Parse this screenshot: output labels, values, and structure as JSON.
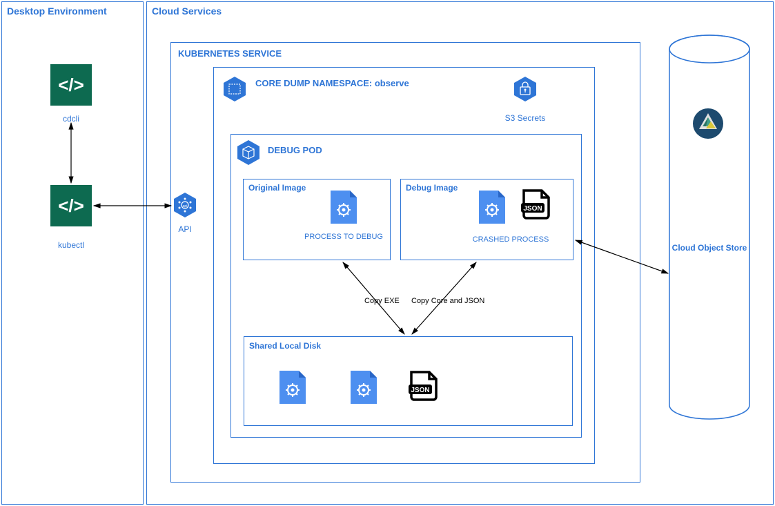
{
  "desktop": {
    "title": "Desktop Environment",
    "cdcli": "cdcli",
    "kubectl": "kubectl"
  },
  "cloud": {
    "title": "Cloud Services",
    "api": "API",
    "kubernetes": {
      "title": "KUBERNETES SERVICE",
      "namespace": {
        "title": "CORE DUMP NAMESPACE: observe",
        "secrets": "S3 Secrets",
        "debugpod": {
          "title": "DEBUG POD",
          "original": {
            "title": "Original Image",
            "label": "PROCESS TO DEBUG"
          },
          "debug": {
            "title": "Debug Image",
            "label": "CRASHED PROCESS"
          },
          "shared": {
            "title": "Shared Local Disk"
          },
          "copyexe": "Copy EXE",
          "copycore": "Copy Core and JSON"
        }
      }
    },
    "objectstore": "Cloud Object Store"
  }
}
